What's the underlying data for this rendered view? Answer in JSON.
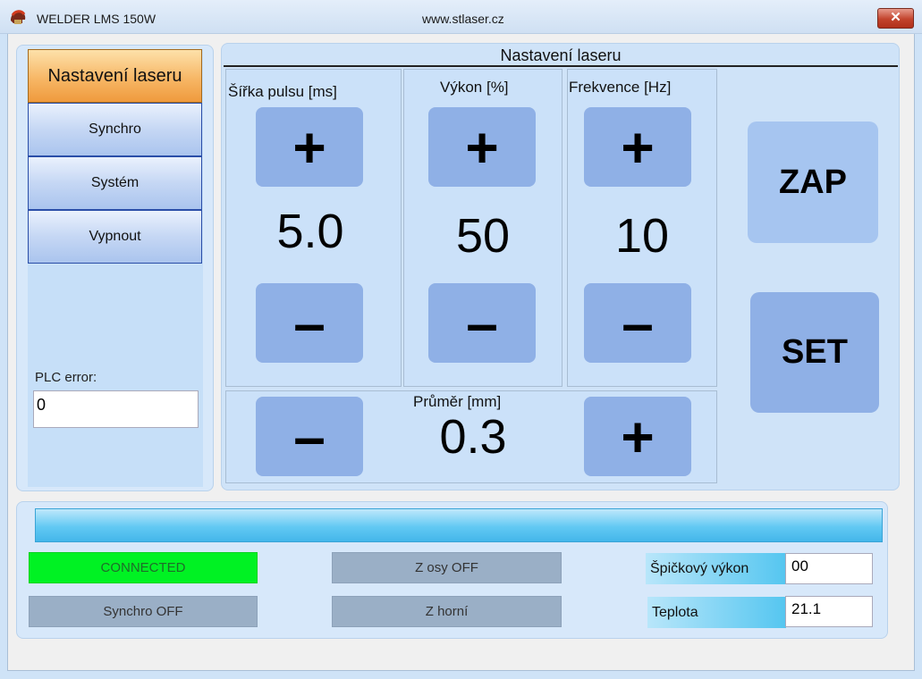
{
  "window": {
    "title": "WELDER LMS 150W",
    "url": "www.stlaser.cz",
    "close_label": "✕"
  },
  "menu": {
    "items": [
      {
        "label": "Nastavení laseru",
        "active": true
      },
      {
        "label": "Synchro"
      },
      {
        "label": "Systém"
      },
      {
        "label": "Vypnout"
      }
    ],
    "plc_error_label": "PLC error:",
    "plc_error_value": "0"
  },
  "settings": {
    "title": "Nastavení laseru",
    "pulse_width": {
      "label": "Šířka pulsu [ms]",
      "value": "5.0"
    },
    "power": {
      "label": "Výkon [%]",
      "value": "50"
    },
    "frequency": {
      "label": "Frekvence [Hz]",
      "value": "10"
    },
    "diameter": {
      "label": "Průměr [mm]",
      "value": "0.3"
    },
    "plus_glyph": "+",
    "minus_glyph": "–",
    "zap_label": "ZAP",
    "set_label": "SET"
  },
  "status": {
    "connected": "CONNECTED",
    "z_axis": "Z osy OFF",
    "synchro": "Synchro OFF",
    "z_top": "Z horní",
    "peak_power_label": "Špičkový výkon",
    "peak_power_value": "00",
    "temperature_label": "Teplota",
    "temperature_value": "21.1"
  },
  "colors": {
    "active_menu": "#f7b766",
    "button": "#8fb0e6",
    "connected": "#00f223",
    "progress": "#43b6ea"
  }
}
